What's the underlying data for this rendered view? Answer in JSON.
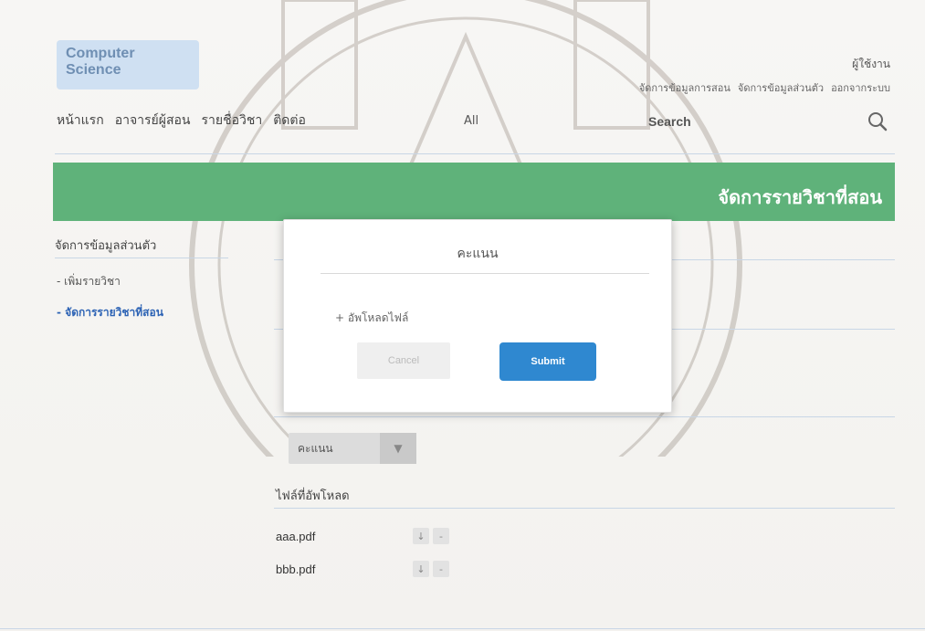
{
  "header": {
    "logo_text": "Computer Science",
    "user_title": "ผู้ใช้งาน",
    "user_menu": [
      "จัดการข้อมูลการสอน",
      "จัดการข้อมูลส่วนตัว",
      "ออกจากระบบ"
    ]
  },
  "nav": {
    "items": [
      "หน้าแรก",
      "อาจารย์ผู้สอน",
      "รายชื่อวิชา",
      "ติดต่อ"
    ],
    "filter_label": "All",
    "search_placeholder": "Search"
  },
  "banner": {
    "title": "จัดการรายวิชาที่สอน",
    "color": "#5fb27a"
  },
  "sidebar": {
    "title": "จัดการข้อมูลส่วนตัว",
    "items": [
      {
        "label": "- เพิ่มรายวิชา",
        "active": false
      },
      {
        "label": "- จัดการรายวิชาที่สอน",
        "active": true
      }
    ]
  },
  "main": {
    "score_button": "คะแนน",
    "uploads_title": "ไฟล์ที่อัพโหลด",
    "files": [
      {
        "name": "aaa.pdf",
        "download_icon": "download-icon",
        "remove_label": "-"
      },
      {
        "name": "bbb.pdf",
        "download_icon": "download-icon",
        "remove_label": "-"
      }
    ]
  },
  "modal": {
    "title": "คะแนน",
    "upload_link": "+ อัพโหลดไฟล์",
    "cancel_label": "Cancel",
    "submit_label": "Submit",
    "submit_color": "#2f88d0"
  }
}
